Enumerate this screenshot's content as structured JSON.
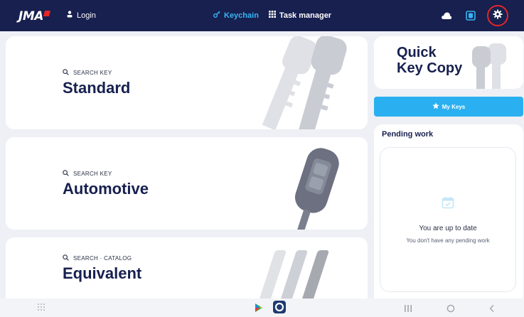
{
  "topbar": {
    "logo": "JMA",
    "login_label": "Login",
    "nav": [
      {
        "label": "Keychain",
        "icon": "key-icon",
        "active": true
      },
      {
        "label": "Task manager",
        "icon": "grid-icon",
        "active": false
      }
    ],
    "icons": [
      "cloud-icon",
      "tablet-icon",
      "gear-icon"
    ]
  },
  "cards": [
    {
      "search": "SEARCH KEY",
      "title": "Standard"
    },
    {
      "search": "SEARCH KEY",
      "title": "Automotive"
    },
    {
      "search": "SEARCH · CATALOG",
      "title": "Equivalent"
    }
  ],
  "quick_copy": {
    "line1": "Quick",
    "line2": "Key Copy"
  },
  "my_keys": {
    "label": "My Keys"
  },
  "pending": {
    "title": "Pending work",
    "status": "You are up to date",
    "subtitle": "You don't have any pending work"
  },
  "colors": {
    "navy": "#17204f",
    "accent": "#2ab0f0",
    "highlight": "#e32626"
  }
}
